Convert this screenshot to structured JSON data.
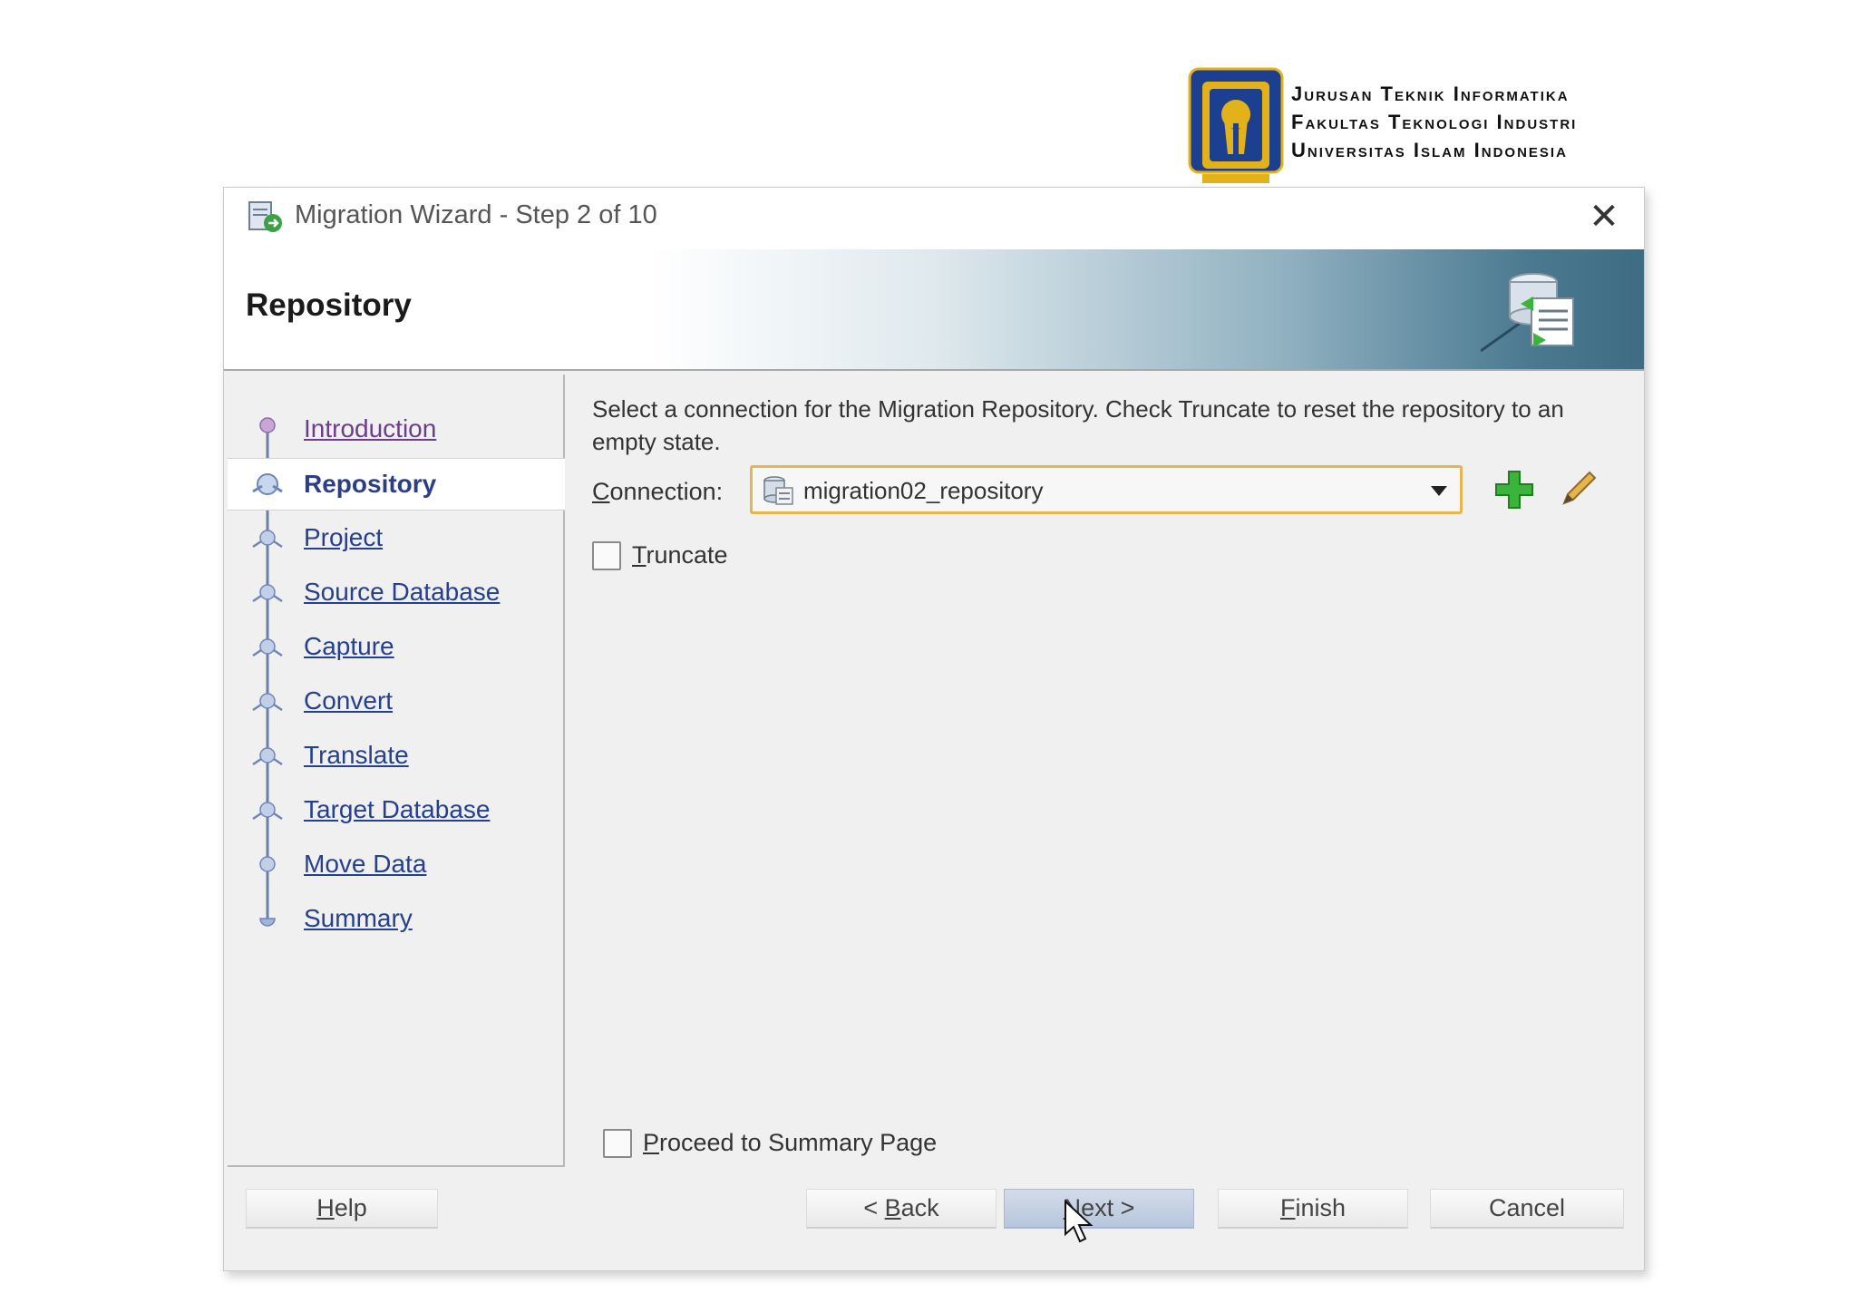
{
  "branding": {
    "lines": [
      "Jurusan Teknik Informatika",
      "Fakultas Teknologi Industri",
      "Universitas Islam Indonesia"
    ],
    "logo_icon": "uii-crest-logo",
    "logo_colors": {
      "navy": "#1d3f8f",
      "gold": "#e3b21a"
    }
  },
  "window": {
    "title": "Migration Wizard - Step 2 of 10",
    "title_icon": "migration-wizard-icon",
    "close_icon": "close-icon"
  },
  "banner": {
    "title": "Repository",
    "icon": "database-repository-icon"
  },
  "steps": {
    "current_index": 1,
    "items": [
      {
        "label": "Introduction",
        "state": "visited"
      },
      {
        "label": "Repository",
        "state": "current"
      },
      {
        "label": "Project",
        "state": "pending"
      },
      {
        "label": "Source Database",
        "state": "pending"
      },
      {
        "label": "Capture",
        "state": "pending"
      },
      {
        "label": "Convert",
        "state": "pending"
      },
      {
        "label": "Translate",
        "state": "pending"
      },
      {
        "label": "Target Database",
        "state": "pending"
      },
      {
        "label": "Move Data",
        "state": "pending"
      },
      {
        "label": "Summary",
        "state": "pending"
      }
    ]
  },
  "content": {
    "instructions": "Select a connection for the Migration Repository.  Check Truncate to reset the repository to an empty state.",
    "connection": {
      "label_mnemonic": "C",
      "label_rest": "onnection:",
      "value": "migration02_repository",
      "icon": "database-connection-icon",
      "add_icon": "add-connection-icon",
      "edit_icon": "edit-connection-icon"
    },
    "truncate": {
      "mnemonic": "T",
      "rest": "runcate",
      "checked": false
    },
    "proceed": {
      "mnemonic": "P",
      "rest": "roceed to Summary Page",
      "checked": false
    }
  },
  "footer": {
    "help": {
      "mnemonic": "H",
      "rest": "elp"
    },
    "back": {
      "prefix": "< ",
      "mnemonic": "B",
      "rest": "ack"
    },
    "next": {
      "mnemonic": "N",
      "rest": "ext >"
    },
    "finish": {
      "mnemonic": "F",
      "rest": "inish"
    },
    "cancel": "Cancel"
  },
  "colors": {
    "link": "#25408f",
    "visited_link": "#6b3d8a",
    "focus_border": "#e2b84c",
    "next_button": "#b7c6dc",
    "add_icon": "#3bb43b"
  }
}
